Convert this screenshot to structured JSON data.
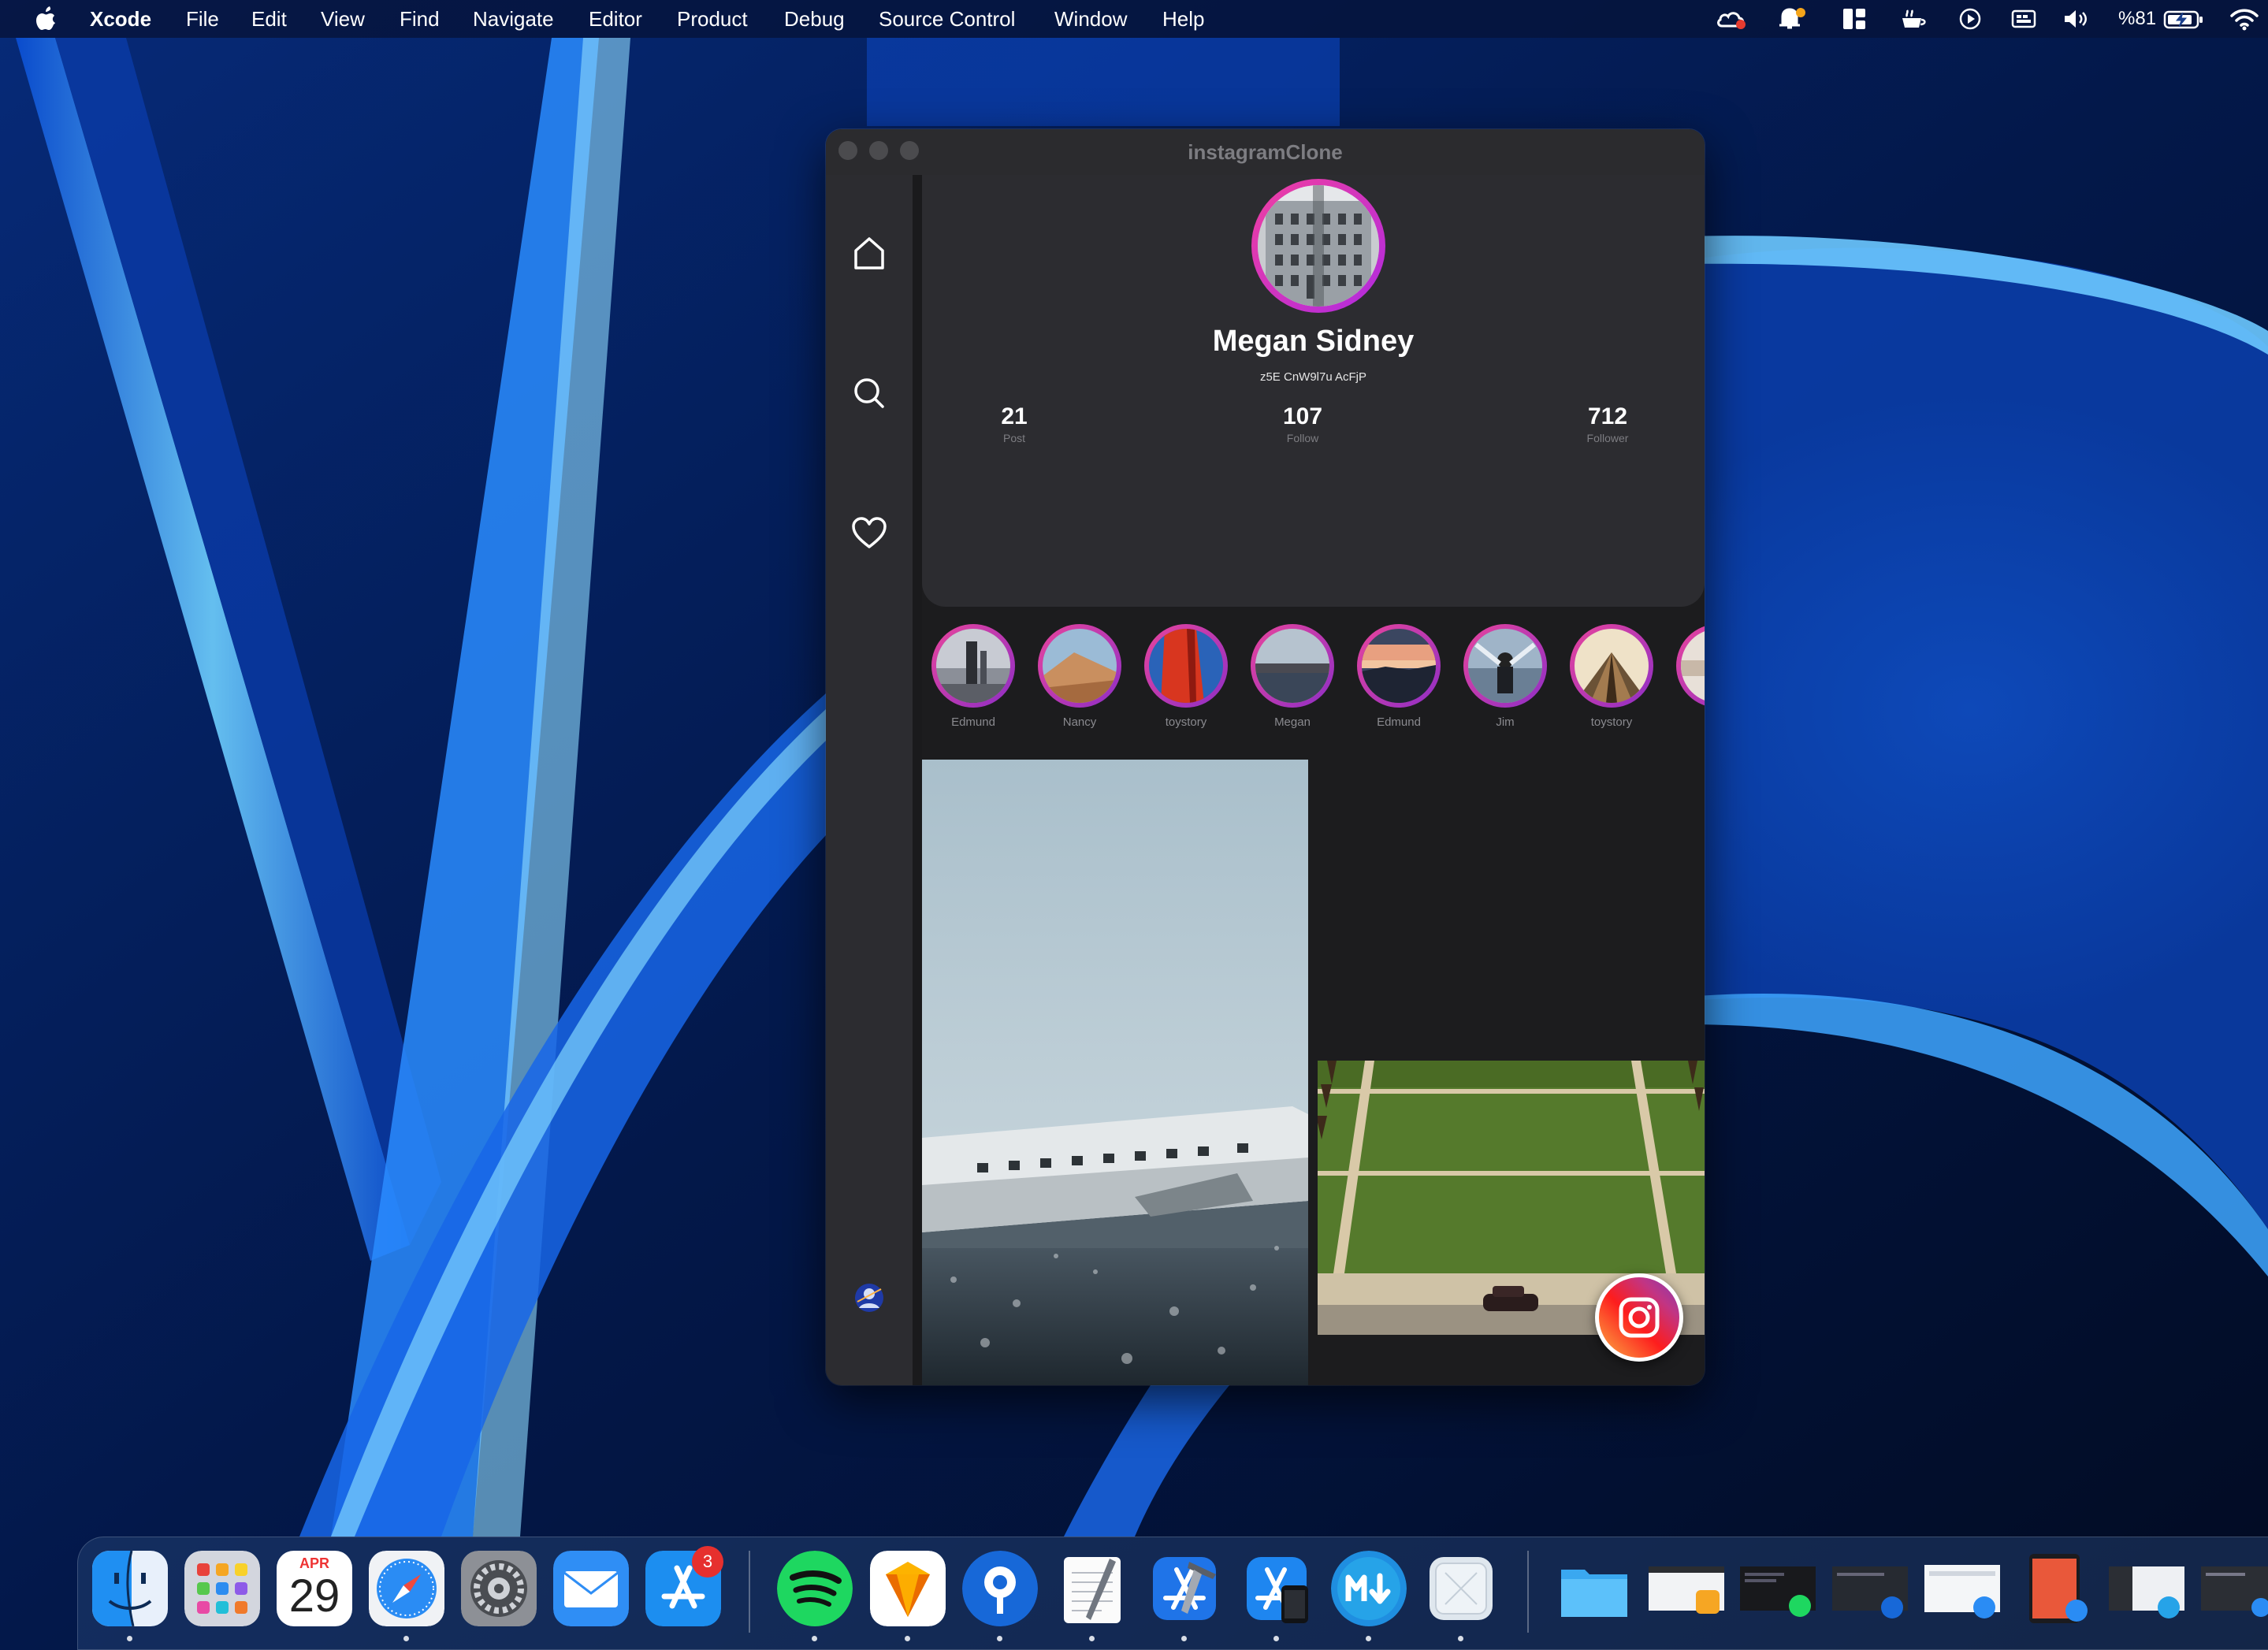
{
  "menubar": {
    "app_name": "Xcode",
    "items": [
      "File",
      "Edit",
      "View",
      "Find",
      "Navigate",
      "Editor",
      "Product",
      "Debug",
      "Source Control",
      "Window",
      "Help"
    ],
    "battery_text": "%81"
  },
  "window": {
    "title": "instagramClone"
  },
  "profile": {
    "name": "Megan Sidney",
    "handle": "z5E CnW9l7u AcFjP",
    "stats": [
      {
        "value": "21",
        "label": "Post"
      },
      {
        "value": "107",
        "label": "Follow"
      },
      {
        "value": "712",
        "label": "Follower"
      }
    ]
  },
  "stories": [
    {
      "name": "Edmund"
    },
    {
      "name": "Nancy"
    },
    {
      "name": "toystory"
    },
    {
      "name": "Megan"
    },
    {
      "name": "Edmund"
    },
    {
      "name": "Jim"
    },
    {
      "name": "toystory"
    }
  ],
  "dock": {
    "calendar_month": "APR",
    "calendar_day": "29",
    "app_store_badge": "3",
    "apps": [
      "finder",
      "launchpad",
      "calendar",
      "safari",
      "system-preferences",
      "mail",
      "app-store",
      "spotify",
      "sketch",
      "sourcetree",
      "textedit",
      "xcode",
      "simulator",
      "markdown-editor",
      "preview",
      "files",
      "window-thumb-1",
      "window-thumb-2",
      "window-thumb-3",
      "window-thumb-4",
      "window-thumb-5",
      "window-thumb-6",
      "window-thumb-7"
    ]
  },
  "colors": {
    "accent_pink": "#e8449c",
    "accent_purple": "#8e2ec6",
    "window_bg": "#1c1c1e",
    "card_bg": "#2c2c30"
  }
}
